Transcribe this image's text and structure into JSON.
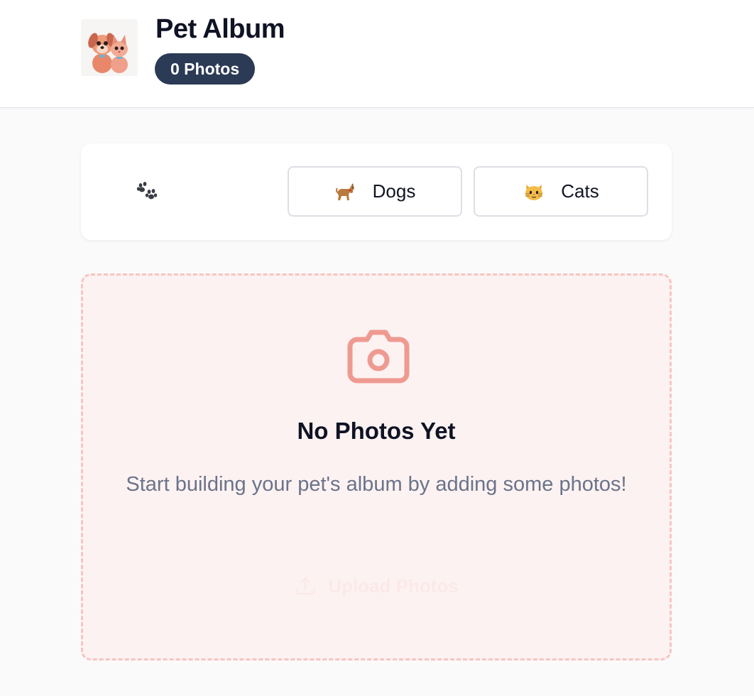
{
  "header": {
    "title": "Pet Album",
    "photo_count": "0 Photos",
    "logo_icon": "cartoon-dog-and-cat-logo"
  },
  "filters": {
    "all_icon": "paw-prints-icon",
    "dogs": {
      "icon": "dog-icon",
      "label": "Dogs"
    },
    "cats": {
      "icon": "cat-face-icon",
      "label": "Cats"
    }
  },
  "empty_state": {
    "icon": "camera-icon",
    "title": "No Photos Yet",
    "description": "Start building your pet's album by adding some photos!",
    "upload_label": "Upload Photos",
    "upload_icon": "upload-icon"
  },
  "colors": {
    "badge_bg": "#2b3a55",
    "camera": "#ef9a91",
    "dropzone_bg": "#fdf2f2",
    "dropzone_border": "#f6c5c1"
  }
}
